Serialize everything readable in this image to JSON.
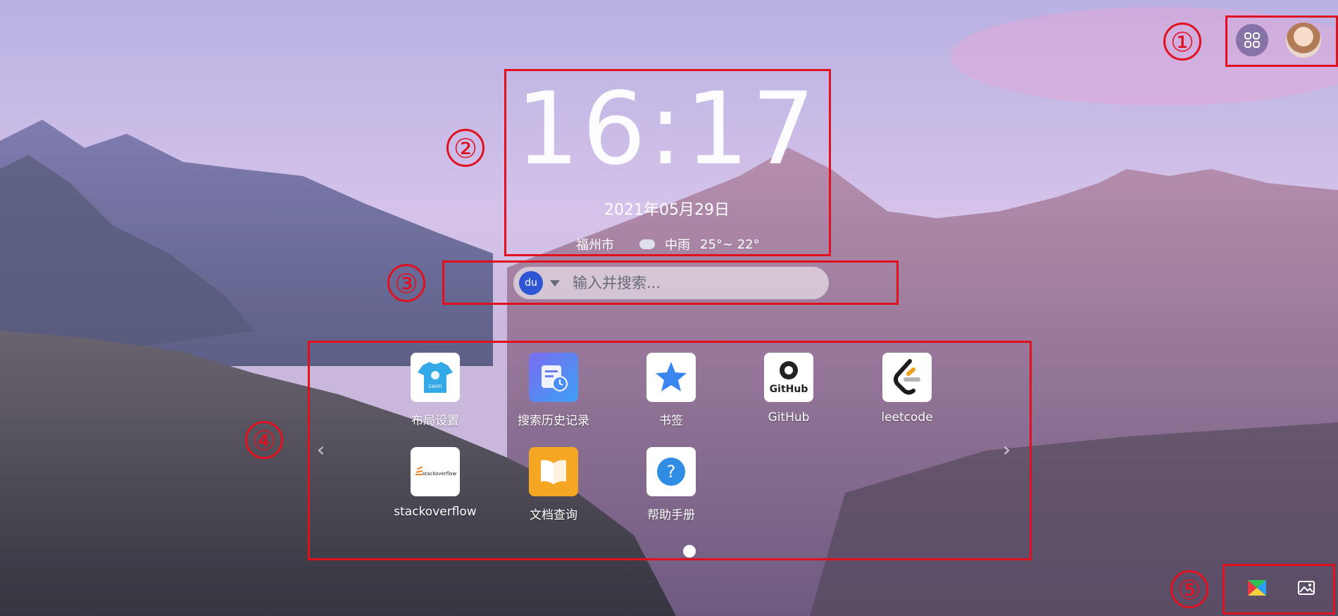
{
  "annotations": [
    "①",
    "②",
    "③",
    "④",
    "⑤"
  ],
  "clock": {
    "time": "16:17",
    "date": "2021年05月29日"
  },
  "weather": {
    "city": "福州市",
    "condition": "中雨",
    "temperature": "25°~ 22°",
    "icon": "cloud-rain-icon"
  },
  "search": {
    "engine_icon": "baidu-paw-icon",
    "engine_text": "du",
    "placeholder": "输入并搜索..."
  },
  "apps": {
    "items": [
      {
        "label": "布局设置",
        "icon": "layout-shirt-icon"
      },
      {
        "label": "搜索历史记录",
        "icon": "history-clock-icon"
      },
      {
        "label": "书签",
        "icon": "star-icon"
      },
      {
        "label": "GitHub",
        "icon": "github-icon"
      },
      {
        "label": "leetcode",
        "icon": "leetcode-icon"
      },
      {
        "label": "stackoverflow",
        "icon": "stackoverflow-icon"
      },
      {
        "label": "文档查询",
        "icon": "book-icon"
      },
      {
        "label": "帮助手册",
        "icon": "help-question-icon"
      }
    ],
    "page_indicator": {
      "current": 1,
      "total": 1
    }
  },
  "tile_text": {
    "caon": "caon",
    "github": "GitHub",
    "stackoverflow": "stackoverflow"
  },
  "colors": {
    "annotation_red": "#e0101f",
    "accent_blue": "#2f55d4"
  }
}
